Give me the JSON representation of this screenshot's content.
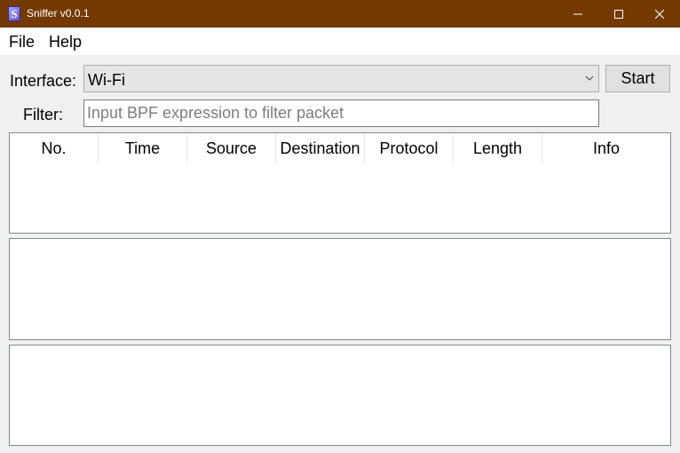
{
  "window": {
    "title": "Sniffer v0.0.1",
    "icon": "sniffer-app-icon",
    "icon_letter": "S",
    "titlebar_color": "#743900"
  },
  "menu": {
    "items": [
      {
        "label": "File"
      },
      {
        "label": "Help"
      }
    ]
  },
  "controls": {
    "interface_label": "Interface:",
    "interface_value": "Wi-Fi",
    "start_label": "Start",
    "filter_label": "Filter:",
    "filter_value": "",
    "filter_placeholder": "Input BPF expression to filter packet"
  },
  "packet_table": {
    "columns": [
      "No.",
      "Time",
      "Source",
      "Destination",
      "Protocol",
      "Length",
      "Info"
    ],
    "rows": []
  },
  "icons": {
    "minimize": "minimize-icon",
    "maximize": "maximize-icon",
    "close": "close-icon",
    "dropdown": "chevron-down-icon"
  }
}
